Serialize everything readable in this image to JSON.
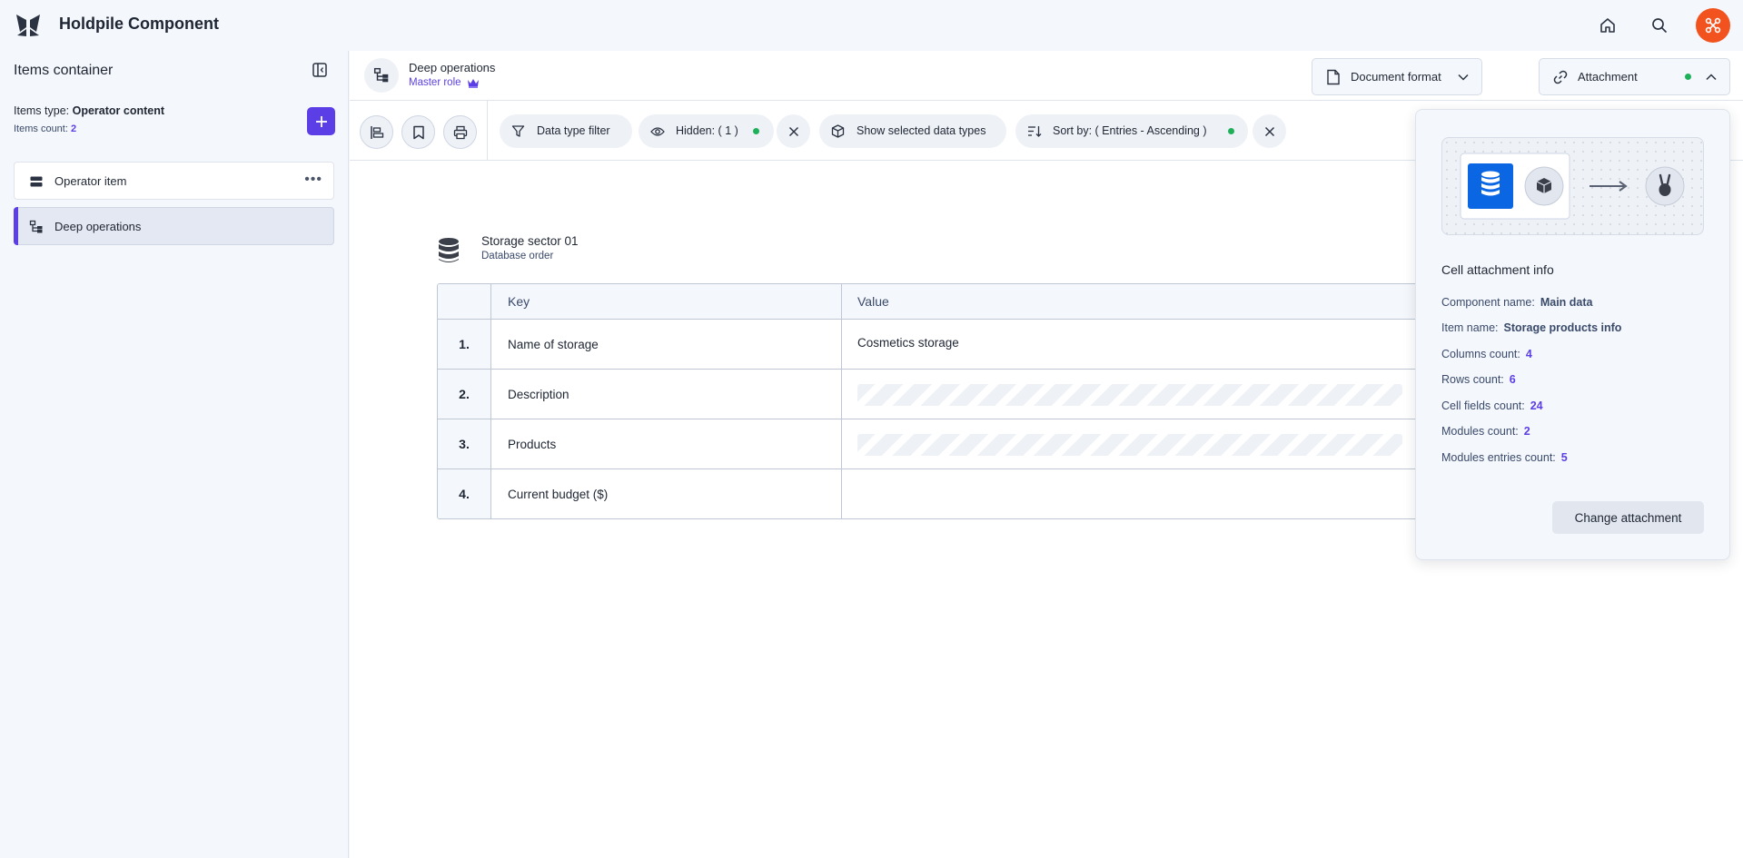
{
  "app": {
    "title": "Holdpile Component"
  },
  "sidebar": {
    "title": "Items container",
    "type_label": "Items type:",
    "type_value": "Operator content",
    "count_label": "Items count:",
    "count_value": "2",
    "items": [
      {
        "label": "Operator item",
        "icon": "server-icon",
        "active": false
      },
      {
        "label": "Deep operations",
        "icon": "hierarchy-icon",
        "active": true
      }
    ]
  },
  "breadcrumb": {
    "title": "Deep operations",
    "role": "Master role"
  },
  "selectors": {
    "document_format": "Document format",
    "attachment": "Attachment"
  },
  "filters": {
    "data_type": "Data type filter",
    "hidden": "Hidden: ( 1 )",
    "show_selected": "Show selected data types",
    "sort_by": "Sort by: ( Entries - Ascending )"
  },
  "storage": {
    "title": "Storage sector 01",
    "subtitle": "Database order",
    "columns": [
      "Key",
      "Value"
    ],
    "rows": [
      {
        "index": "1.",
        "key": "Name of storage",
        "value": "Cosmetics storage"
      },
      {
        "index": "2.",
        "key": "Description",
        "value": ""
      },
      {
        "index": "3.",
        "key": "Products",
        "value": ""
      },
      {
        "index": "4.",
        "key": "Current budget ($)",
        "value": ""
      }
    ]
  },
  "attachment_info": {
    "title": "Cell attachment info",
    "component_label": "Component name:",
    "component_value": "Main data",
    "item_label": "Item name:",
    "item_value": "Storage products info",
    "columns_label": "Columns count:",
    "columns_value": "4",
    "rows_label": "Rows count:",
    "rows_value": "6",
    "cells_label": "Cell fields count:",
    "cells_value": "24",
    "modules_label": "Modules count:",
    "modules_value": "2",
    "entries_label": "Modules entries count:",
    "entries_value": "5",
    "change_button": "Change attachment"
  },
  "colors": {
    "accent": "#5b3ee6",
    "avatar": "#f2531e",
    "status": "#1fb05a",
    "database_tile": "#0b66e4"
  }
}
